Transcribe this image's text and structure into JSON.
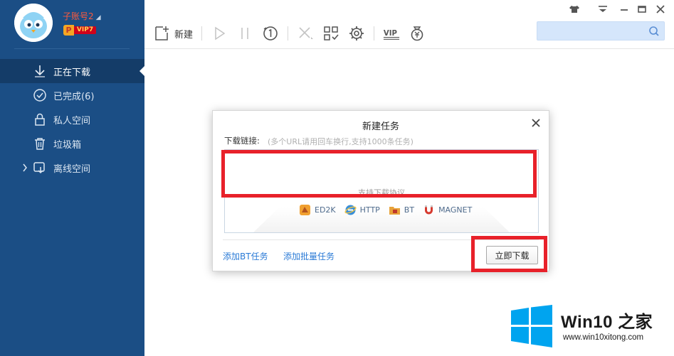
{
  "user": {
    "name": "子账号2",
    "vip_letter": "P",
    "vip_level": "VIP7"
  },
  "sidebar": {
    "items": [
      {
        "label": "正在下载",
        "icon": "download-arrow-icon",
        "active": true
      },
      {
        "label": "已完成(6)",
        "icon": "check-circle-icon"
      },
      {
        "label": "私人空间",
        "icon": "lock-icon"
      },
      {
        "label": "垃圾箱",
        "icon": "trash-icon"
      },
      {
        "label": "离线空间",
        "icon": "cloud-download-icon",
        "expandable": true
      }
    ]
  },
  "toolbar": {
    "new_label": "新建",
    "vip_icon_text": "VIP"
  },
  "search": {
    "placeholder": ""
  },
  "dialog": {
    "title": "新建任务",
    "link_label": "下载链接:",
    "link_hint": "(多个URL请用回车换行,支持1000条任务)",
    "protocol_hint": "支持下载协议",
    "protocols": [
      "ED2K",
      "HTTP",
      "BT",
      "MAGNET"
    ],
    "add_bt": "添加BT任务",
    "add_batch": "添加批量任务",
    "download_now": "立即下载"
  },
  "watermark": {
    "title": "Win10 之家",
    "url": "www.win10xitong.com"
  },
  "colors": {
    "sidebar": "#1b4e85",
    "sidebar_active": "#143c68",
    "highlight_red": "#e8212a",
    "link_blue": "#2a7ad6",
    "win_blue": "#00a4ef"
  }
}
